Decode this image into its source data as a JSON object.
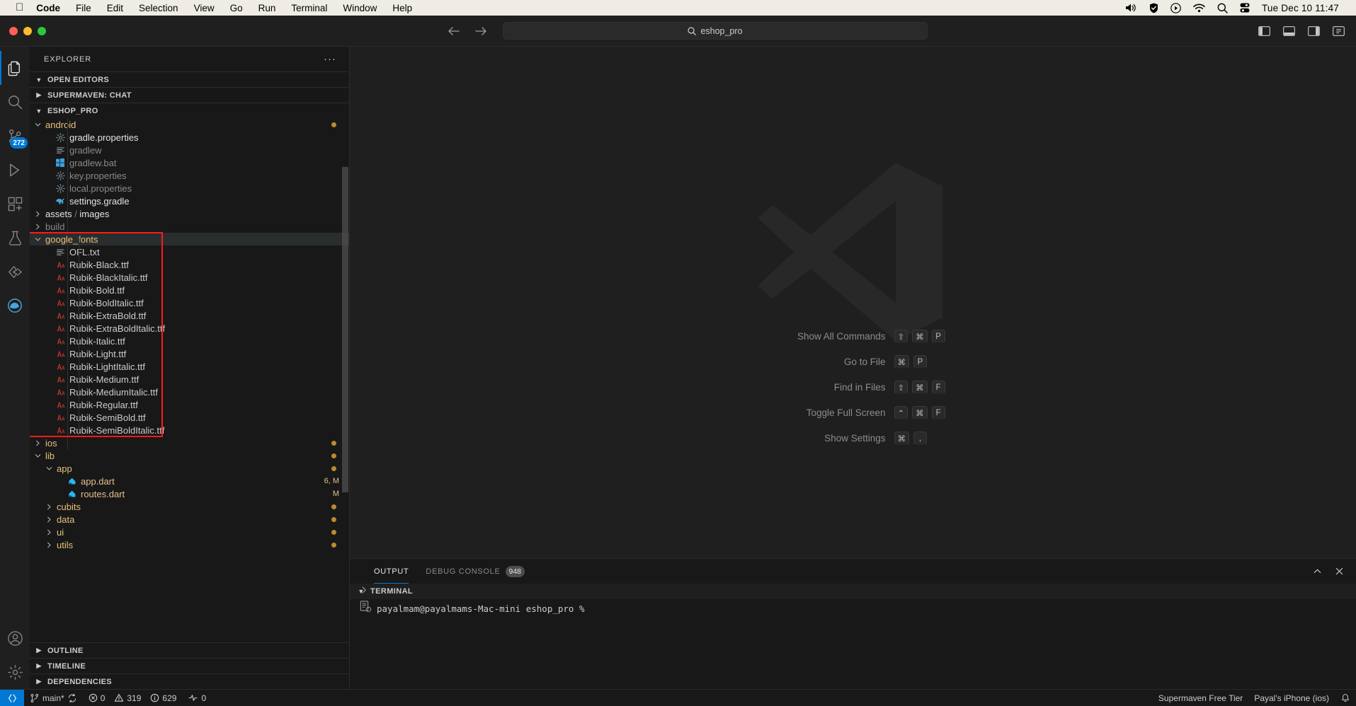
{
  "macmenu": {
    "apple": "apple-logo",
    "items": [
      "Code",
      "File",
      "Edit",
      "Selection",
      "View",
      "Go",
      "Run",
      "Terminal",
      "Window",
      "Help"
    ],
    "status_icons": [
      "volume-icon",
      "shield-check-icon",
      "play-circle-icon",
      "wifi-icon",
      "search-icon",
      "control-center-icon"
    ],
    "clock": "Tue Dec 10  11:47"
  },
  "titlebar": {
    "back_icon": "back-arrow-icon",
    "forward_icon": "forward-arrow-icon",
    "search_icon": "search-icon",
    "command_center_text": "eshop_pro",
    "layout_icons": [
      "toggle-primary-sidebar-icon",
      "toggle-panel-icon",
      "toggle-secondary-sidebar-icon",
      "customize-layout-icon"
    ]
  },
  "activitybar": {
    "items": [
      {
        "name": "explorer-icon",
        "active": true,
        "badge": ""
      },
      {
        "name": "search-icon",
        "active": false,
        "badge": ""
      },
      {
        "name": "source-control-icon",
        "active": false,
        "badge": "272"
      },
      {
        "name": "run-and-debug-icon",
        "active": false,
        "badge": ""
      },
      {
        "name": "extensions-icon",
        "active": false,
        "badge": ""
      },
      {
        "name": "testing-icon",
        "active": false,
        "badge": ""
      },
      {
        "name": "supermaven-icon",
        "active": false,
        "badge": ""
      },
      {
        "name": "edge-tools-icon",
        "active": false,
        "badge": ""
      }
    ],
    "bottom_items": [
      {
        "name": "accounts-icon"
      },
      {
        "name": "manage-gear-icon"
      }
    ]
  },
  "explorer": {
    "title": "EXPLORER",
    "more_actions": "···",
    "sections": [
      {
        "label": "OPEN EDITORS",
        "expanded": true
      },
      {
        "label": "SUPERMAVEN: CHAT",
        "expanded": false
      },
      {
        "label": "ESHOP_PRO",
        "expanded": true
      }
    ],
    "bottom_sections": [
      {
        "label": "OUTLINE",
        "expanded": false
      },
      {
        "label": "TIMELINE",
        "expanded": false
      },
      {
        "label": "DEPENDENCIES",
        "expanded": false
      }
    ],
    "tree": [
      {
        "label": "android",
        "type": "folder",
        "expanded": true,
        "depth": 1,
        "git": "dot"
      },
      {
        "label": "gradle.properties",
        "type": "properties",
        "depth": 2,
        "style": "bright"
      },
      {
        "label": "gradlew",
        "type": "text",
        "depth": 2,
        "style": "dim"
      },
      {
        "label": "gradlew.bat",
        "type": "windows",
        "depth": 2,
        "style": "dim"
      },
      {
        "label": "key.properties",
        "type": "properties",
        "depth": 2,
        "style": "dim"
      },
      {
        "label": "local.properties",
        "type": "properties",
        "depth": 2,
        "style": "dim"
      },
      {
        "label": "settings.gradle",
        "type": "gradle",
        "depth": 2,
        "style": "bright"
      },
      {
        "label": "assets / images",
        "type": "folder",
        "expanded": false,
        "depth": 1,
        "style": "bright-folder"
      },
      {
        "label": "build",
        "type": "folder",
        "expanded": false,
        "depth": 1,
        "style": "dim-folder"
      },
      {
        "label": "google_fonts",
        "type": "folder",
        "expanded": true,
        "depth": 1,
        "selected": true
      },
      {
        "label": "OFL.txt",
        "type": "text",
        "depth": 2
      },
      {
        "label": "Rubik-Black.ttf",
        "type": "font",
        "depth": 2
      },
      {
        "label": "Rubik-BlackItalic.ttf",
        "type": "font",
        "depth": 2
      },
      {
        "label": "Rubik-Bold.ttf",
        "type": "font",
        "depth": 2
      },
      {
        "label": "Rubik-BoldItalic.ttf",
        "type": "font",
        "depth": 2
      },
      {
        "label": "Rubik-ExtraBold.ttf",
        "type": "font",
        "depth": 2
      },
      {
        "label": "Rubik-ExtraBoldItalic.ttf",
        "type": "font",
        "depth": 2
      },
      {
        "label": "Rubik-Italic.ttf",
        "type": "font",
        "depth": 2
      },
      {
        "label": "Rubik-Light.ttf",
        "type": "font",
        "depth": 2
      },
      {
        "label": "Rubik-LightItalic.ttf",
        "type": "font",
        "depth": 2
      },
      {
        "label": "Rubik-Medium.ttf",
        "type": "font",
        "depth": 2
      },
      {
        "label": "Rubik-MediumItalic.ttf",
        "type": "font",
        "depth": 2
      },
      {
        "label": "Rubik-Regular.ttf",
        "type": "font",
        "depth": 2
      },
      {
        "label": "Rubik-SemiBold.ttf",
        "type": "font",
        "depth": 2
      },
      {
        "label": "Rubik-SemiBoldItalic.ttf",
        "type": "font",
        "depth": 2
      },
      {
        "label": "ios",
        "type": "folder",
        "expanded": false,
        "depth": 1,
        "git": "dot"
      },
      {
        "label": "lib",
        "type": "folder",
        "expanded": true,
        "depth": 1,
        "git": "dot"
      },
      {
        "label": "app",
        "type": "folder",
        "expanded": true,
        "depth": 2,
        "git": "dot"
      },
      {
        "label": "app.dart",
        "type": "dart",
        "depth": 3,
        "style": "mod",
        "git": "6, M"
      },
      {
        "label": "routes.dart",
        "type": "dart",
        "depth": 3,
        "style": "mod",
        "git": "M"
      },
      {
        "label": "cubits",
        "type": "folder",
        "expanded": false,
        "depth": 2,
        "git": "dot"
      },
      {
        "label": "data",
        "type": "folder",
        "expanded": false,
        "depth": 2,
        "style": "mod-folder",
        "git": "dot"
      },
      {
        "label": "ui",
        "type": "folder",
        "expanded": false,
        "depth": 2,
        "git": "dot"
      },
      {
        "label": "utils",
        "type": "folder",
        "expanded": false,
        "depth": 2,
        "style": "mod-folder",
        "git": "dot"
      }
    ],
    "annotation": {
      "color": "#ff1a1a",
      "label": "google-fonts-highlight"
    }
  },
  "editor": {
    "watermark": "vscode-logo-watermark",
    "shortcuts": [
      {
        "label": "Show All Commands",
        "keys": [
          "⇧",
          "⌘",
          "P"
        ]
      },
      {
        "label": "Go to File",
        "keys": [
          "⌘",
          "P"
        ]
      },
      {
        "label": "Find in Files",
        "keys": [
          "⇧",
          "⌘",
          "F"
        ]
      },
      {
        "label": "Toggle Full Screen",
        "keys": [
          "⌃",
          "⌘",
          "F"
        ]
      },
      {
        "label": "Show Settings",
        "keys": [
          "⌘",
          ","
        ]
      }
    ]
  },
  "panel": {
    "tabs": [
      {
        "label": "OUTPUT",
        "active": true,
        "badge": ""
      },
      {
        "label": "DEBUG CONSOLE",
        "active": false,
        "badge": "948"
      }
    ],
    "actions": [
      "chevron-up-icon",
      "close-icon"
    ],
    "terminal_section": "TERMINAL",
    "terminal_prompt": "payalmam@payalmams-Mac-mini eshop_pro %",
    "gutter_icons": [
      "chevron-right-icon",
      "terminal-notes-icon"
    ]
  },
  "statusbar": {
    "remote_icon": "remote-window-icon",
    "branch": "main*",
    "sync_icon": "sync-icon",
    "errors": "0",
    "warnings": "319",
    "infos": "629",
    "ports": "0",
    "right_items": [
      "Supermaven Free Tier",
      "Payal's iPhone (ios)"
    ],
    "bell_icon": "bell-icon",
    "accent": "#0078d4"
  }
}
